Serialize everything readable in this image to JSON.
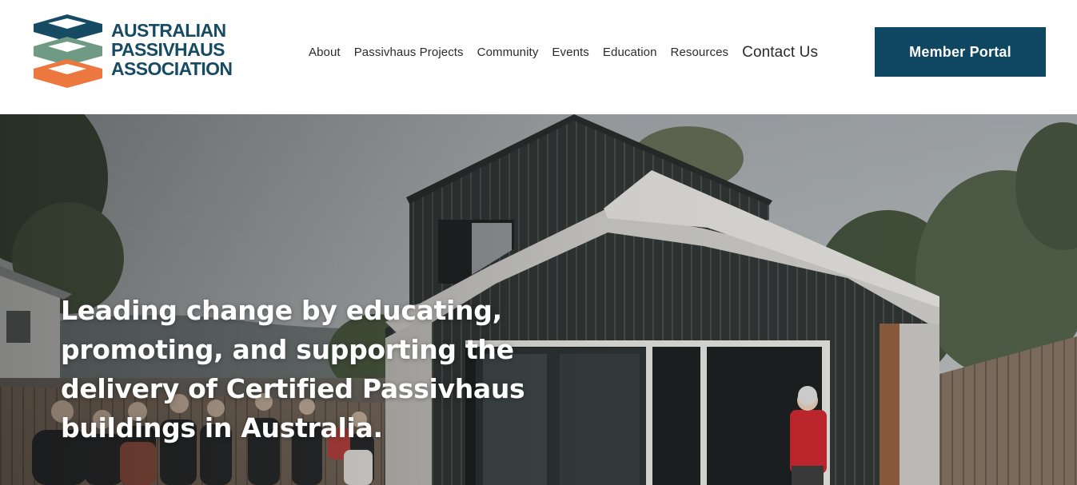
{
  "brand": {
    "line1": "AUSTRALIAN",
    "line2": "PASSIVHAUS",
    "line3": "ASSOCIATION",
    "colors": {
      "navy": "#174a63",
      "green": "#6f9a83",
      "orange": "#ec7840"
    }
  },
  "nav": {
    "items": [
      {
        "label": "About"
      },
      {
        "label": "Passivhaus Projects"
      },
      {
        "label": "Community"
      },
      {
        "label": "Events"
      },
      {
        "label": "Education"
      },
      {
        "label": "Resources"
      }
    ],
    "contact": "Contact Us",
    "portal": "Member Portal",
    "portal_color": "#0f4662"
  },
  "hero": {
    "heading": "Leading change by educating, promoting, and supporting the delivery of Certified Passivhaus buildings in Australia."
  }
}
